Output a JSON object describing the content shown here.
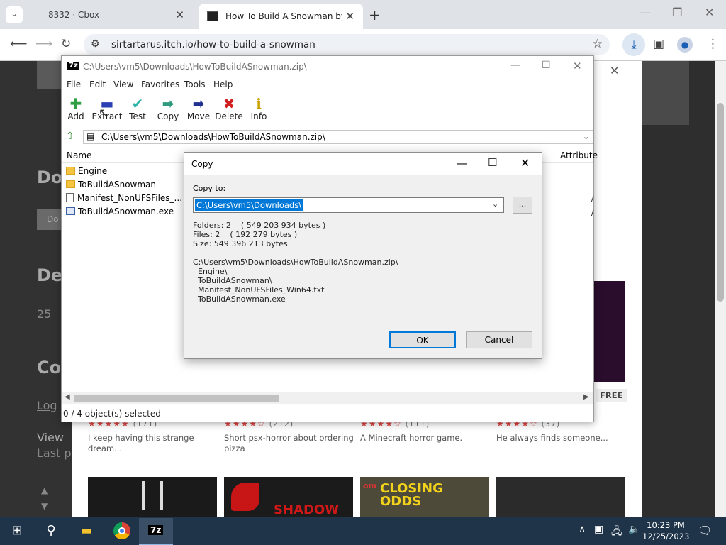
{
  "browser": {
    "tabs": [
      {
        "title": "8332 · Cbox"
      },
      {
        "title": "How To Build A Snowman by Si"
      }
    ],
    "url": "sirtartarus.itch.io/how-to-build-a-snowman"
  },
  "webpage": {
    "left_texts": [
      "Do",
      "Do",
      "De",
      "25",
      "Co",
      "Log",
      "View",
      "Last p"
    ],
    "free_badge": "FREE",
    "cards": [
      {
        "rating": "★★★★★",
        "count": "(171)",
        "desc": "I keep having this strange dream..."
      },
      {
        "rating": "★★★★☆",
        "count": "(212)",
        "desc": "Short psx-horror about ordering pizza"
      },
      {
        "rating": "★★★★☆",
        "count": "(111)",
        "desc": "A Minecraft horror game."
      },
      {
        "rating": "★★★★☆",
        "count": "(37)",
        "desc": "He always finds someone..."
      }
    ],
    "thumb_text": [
      "SHADOW",
      "CLOSING ODDS",
      "om"
    ]
  },
  "sevenzip": {
    "title": "C:\\Users\\vm5\\Downloads\\HowToBuildASnowman.zip\\",
    "menu": [
      "File",
      "Edit",
      "View",
      "Favorites",
      "Tools",
      "Help"
    ],
    "toolbar": [
      {
        "label": "Add",
        "icon": "plus-icon",
        "glyph": "✚",
        "color": "#2ea043"
      },
      {
        "label": "Extract",
        "icon": "minus-icon",
        "glyph": "▬",
        "color": "#2b3fb5"
      },
      {
        "label": "Test",
        "icon": "check-icon",
        "glyph": "✔",
        "color": "#2fb5a8"
      },
      {
        "label": "Copy",
        "icon": "copy-arrow-icon",
        "glyph": "➡",
        "color": "#2f9a7e"
      },
      {
        "label": "Move",
        "icon": "move-arrow-icon",
        "glyph": "➡",
        "color": "#1f2f8f"
      },
      {
        "label": "Delete",
        "icon": "delete-x-icon",
        "glyph": "✖",
        "color": "#d02020"
      },
      {
        "label": "Info",
        "icon": "info-icon",
        "glyph": "i",
        "color": "#c9a000"
      }
    ],
    "path": "C:\\Users\\vm5\\Downloads\\HowToBuildASnowman.zip\\",
    "columns": {
      "name": "Name",
      "attributes": "Attribute"
    },
    "files": [
      {
        "name": "Engine",
        "type": "folder"
      },
      {
        "name": "ToBuildASnowman",
        "type": "folder"
      },
      {
        "name": "Manifest_NonUFSFiles_...",
        "type": "text"
      },
      {
        "name": "ToBuildASnowman.exe",
        "type": "exe"
      }
    ],
    "status": "0 / 4 object(s) selected"
  },
  "copy_dialog": {
    "title": "Copy",
    "copy_to_label": "Copy to:",
    "copy_to_value": "C:\\Users\\vm5\\Downloads\\",
    "browse_label": "...",
    "stats": [
      "Folders: 2    ( 549 203 934 bytes )",
      "Files: 2    ( 192 279 bytes )",
      "Size: 549 396 213 bytes"
    ],
    "source_list": [
      "C:\\Users\\vm5\\Downloads\\HowToBuildASnowman.zip\\",
      "  Engine\\",
      "  ToBuildASnowman\\",
      "  Manifest_NonUFSFiles_Win64.txt",
      "  ToBuildASnowman.exe"
    ],
    "ok_label": "OK",
    "cancel_label": "Cancel"
  },
  "taskbar": {
    "time": "10:23 PM",
    "date": "12/25/2023"
  }
}
